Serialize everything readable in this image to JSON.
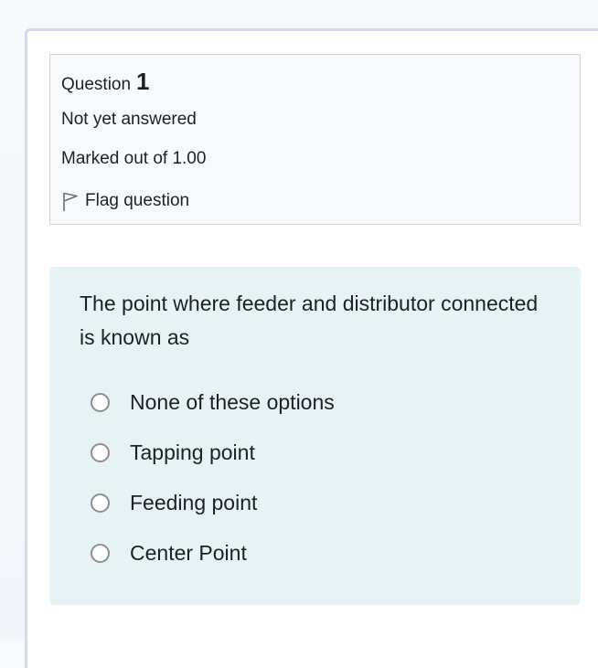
{
  "question_info": {
    "label": "Question",
    "number": "1",
    "status": "Not yet answered",
    "marks": "Marked out of 1.00",
    "flag_label": "Flag question"
  },
  "question": {
    "text": "The point where feeder and distributor connected is known as",
    "options": [
      {
        "label": "None of these options",
        "selected": false
      },
      {
        "label": "Tapping point",
        "selected": false
      },
      {
        "label": "Feeding point",
        "selected": false
      },
      {
        "label": "Center Point",
        "selected": false
      }
    ]
  },
  "colors": {
    "content_background": "#e6f2f4",
    "info_background": "#f8f9fa",
    "card_border": "#d4d9ee"
  },
  "icons": {
    "flag": "flag-icon",
    "radio": "radio-unchecked-icon"
  }
}
